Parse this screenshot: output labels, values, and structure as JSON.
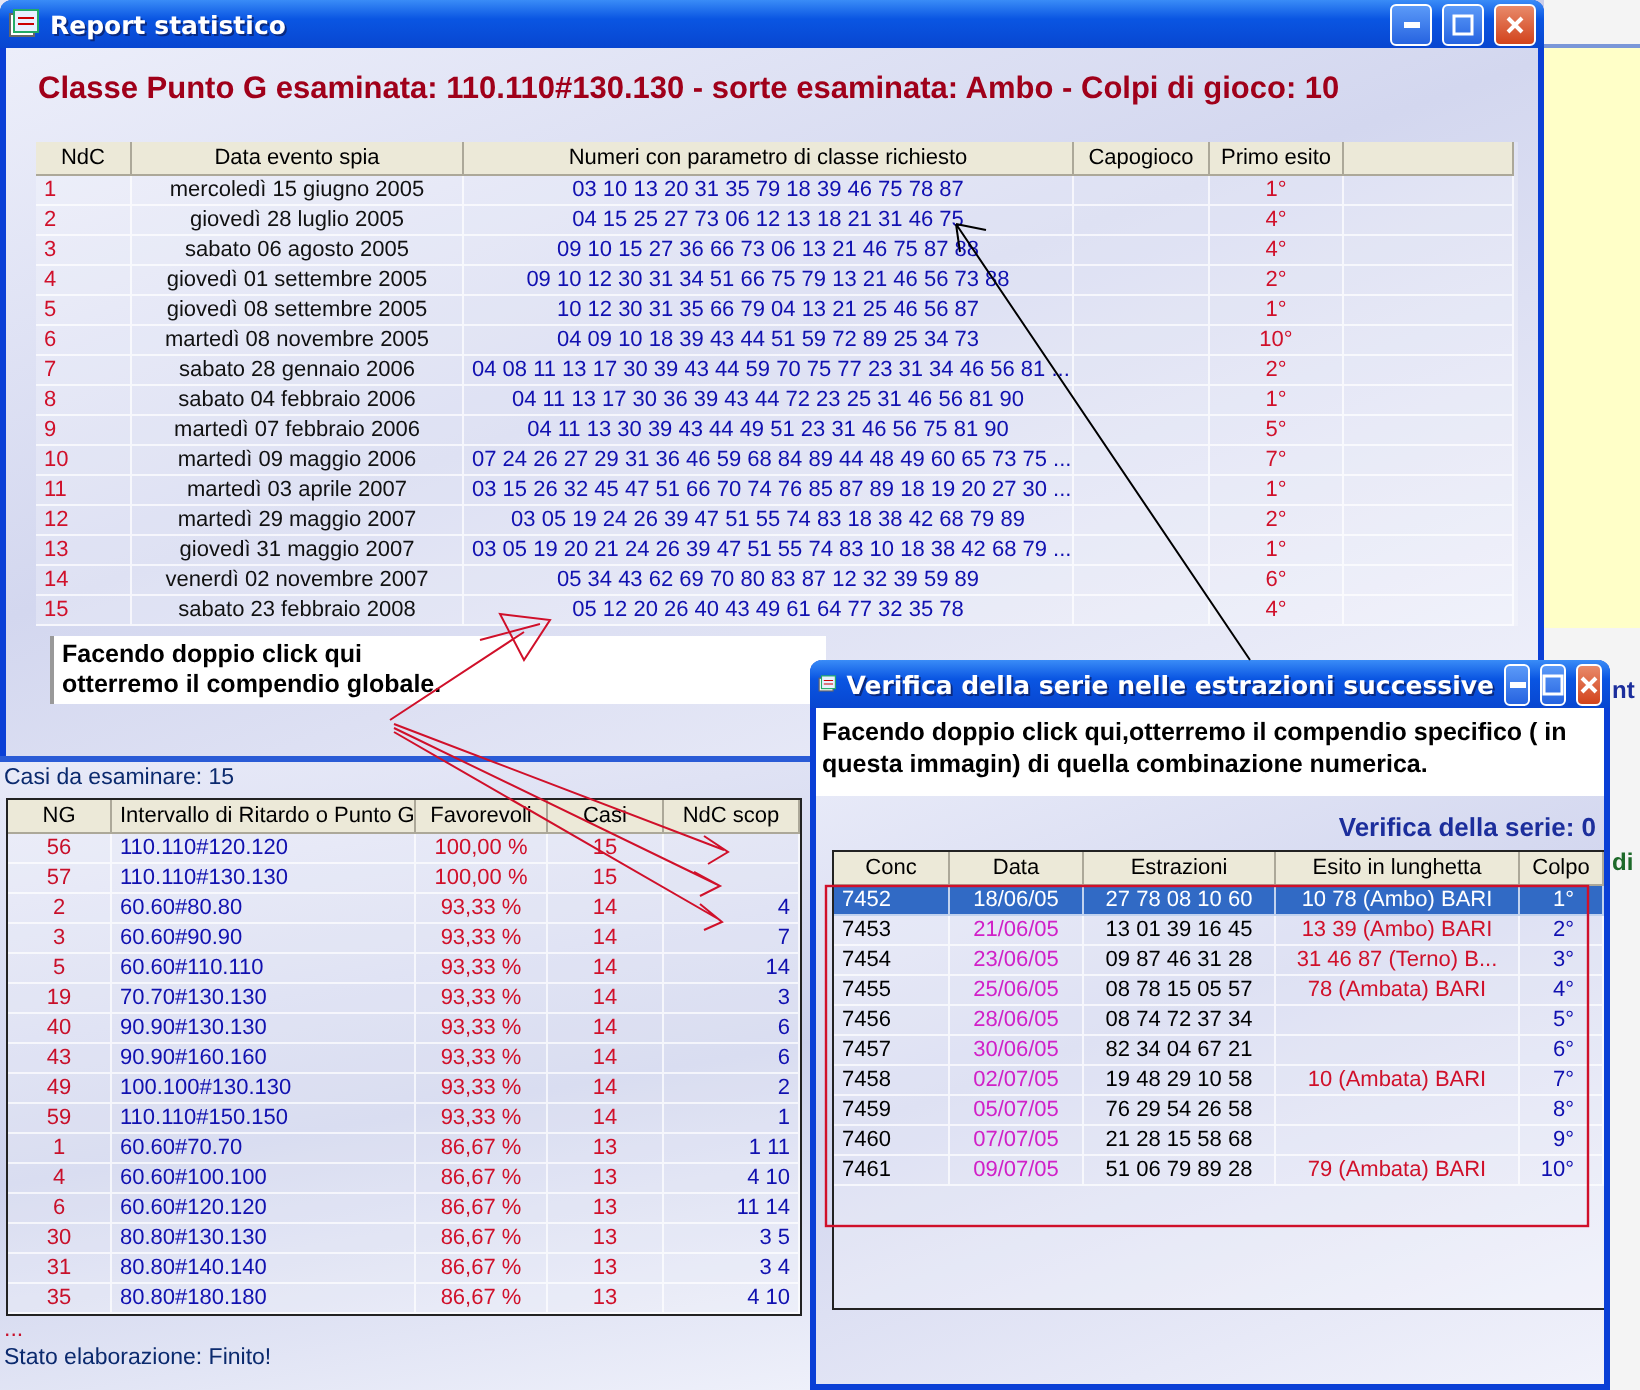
{
  "main_window": {
    "title": "Report statistico",
    "heading": "Classe Punto G esaminata: 110.110#130.130 - sorte esaminata: Ambo - Colpi di gioco: 10",
    "table": {
      "columns": [
        "NdC",
        "Data evento spia",
        "Numeri con parametro di classe richiesto",
        "Capogioco",
        "Primo esito"
      ],
      "rows": [
        {
          "ndc": "1",
          "data": "mercoledì 15 giugno 2005",
          "numeri": "03 10 13 20 31 35 79 18 39 46 75 78 87",
          "primo_esito": "1°"
        },
        {
          "ndc": "2",
          "data": "giovedì 28 luglio 2005",
          "numeri": "04 15 25 27 73 06 12 13 18 21 31 46 75",
          "primo_esito": "4°"
        },
        {
          "ndc": "3",
          "data": "sabato 06 agosto 2005",
          "numeri": "09 10 15 27 36 66 73 06 13 21 46 75 87 88",
          "primo_esito": "4°"
        },
        {
          "ndc": "4",
          "data": "giovedì 01 settembre 2005",
          "numeri": "09 10 12 30 31 34 51 66 75 79 13 21 46 56 73 88",
          "primo_esito": "2°"
        },
        {
          "ndc": "5",
          "data": "giovedì 08 settembre 2005",
          "numeri": "10 12 30 31 35 66 79 04 13 21 25 46 56 87",
          "primo_esito": "1°"
        },
        {
          "ndc": "6",
          "data": "martedì 08 novembre 2005",
          "numeri": "04 09 10 18 39 43 44 51 59 72 89 25 34 73",
          "primo_esito": "10°"
        },
        {
          "ndc": "7",
          "data": "sabato 28 gennaio 2006",
          "numeri": "04 08 11 13 17 30 39 43 44 59 70 75 77 23 31 34 46 56 81 ...",
          "primo_esito": "2°"
        },
        {
          "ndc": "8",
          "data": "sabato 04 febbraio 2006",
          "numeri": "04 11 13 17 30 36 39 43 44 72 23 25 31 46 56 81 90",
          "primo_esito": "1°"
        },
        {
          "ndc": "9",
          "data": "martedì 07 febbraio 2006",
          "numeri": "04 11 13 30 39 43 44 49 51 23 31 46 56 75 81 90",
          "primo_esito": "5°"
        },
        {
          "ndc": "10",
          "data": "martedì 09 maggio 2006",
          "numeri": "07 24 26 27 29 31 36 46 59 68 84 89 44 48 49 60 65 73 75 ...",
          "primo_esito": "7°"
        },
        {
          "ndc": "11",
          "data": "martedì 03 aprile 2007",
          "numeri": "03 15 26 32 45 47 51 66 70 74 76 85 87 89 18 19 20 27 30 ...",
          "primo_esito": "1°"
        },
        {
          "ndc": "12",
          "data": "martedì 29 maggio 2007",
          "numeri": "03 05 19 24 26 39 47 51 55 74 83 18 38 42 68 79 89",
          "primo_esito": "2°"
        },
        {
          "ndc": "13",
          "data": "giovedì 31 maggio 2007",
          "numeri": "03 05 19 20 21 24 26 39 47 51 55 74 83 10 18 38 42 68 79 ...",
          "primo_esito": "1°"
        },
        {
          "ndc": "14",
          "data": "venerdì 02 novembre 2007",
          "numeri": "05 34 43 62 69 70 80 83 87 12 32 39 59 89",
          "primo_esito": "6°"
        },
        {
          "ndc": "15",
          "data": "sabato 23 febbraio 2008",
          "numeri": "05 12 20 26 40 43 49 61 64 77 32 35 78",
          "primo_esito": "4°"
        }
      ]
    },
    "note": [
      "Facendo doppio click qui",
      "otterremo il compendio globale."
    ]
  },
  "cases_panel": {
    "caption": "Casi da esaminare: 15",
    "table": {
      "columns": [
        "NG",
        "Intervallo di Ritardo o Punto G",
        "Favorevoli",
        "Casi",
        "NdC scop"
      ],
      "rows": [
        {
          "ng": "56",
          "intervallo": "110.110#120.120",
          "favorevoli": "100,00 %",
          "casi": "15",
          "ndc": ""
        },
        {
          "ng": "57",
          "intervallo": "110.110#130.130",
          "favorevoli": "100,00 %",
          "casi": "15",
          "ndc": ""
        },
        {
          "ng": "2",
          "intervallo": "60.60#80.80",
          "favorevoli": "93,33 %",
          "casi": "14",
          "ndc": "4"
        },
        {
          "ng": "3",
          "intervallo": "60.60#90.90",
          "favorevoli": "93,33 %",
          "casi": "14",
          "ndc": "7"
        },
        {
          "ng": "5",
          "intervallo": "60.60#110.110",
          "favorevoli": "93,33 %",
          "casi": "14",
          "ndc": "14"
        },
        {
          "ng": "19",
          "intervallo": "70.70#130.130",
          "favorevoli": "93,33 %",
          "casi": "14",
          "ndc": "3"
        },
        {
          "ng": "40",
          "intervallo": "90.90#130.130",
          "favorevoli": "93,33 %",
          "casi": "14",
          "ndc": "6"
        },
        {
          "ng": "43",
          "intervallo": "90.90#160.160",
          "favorevoli": "93,33 %",
          "casi": "14",
          "ndc": "6"
        },
        {
          "ng": "49",
          "intervallo": "100.100#130.130",
          "favorevoli": "93,33 %",
          "casi": "14",
          "ndc": "2"
        },
        {
          "ng": "59",
          "intervallo": "110.110#150.150",
          "favorevoli": "93,33 %",
          "casi": "14",
          "ndc": "1"
        },
        {
          "ng": "1",
          "intervallo": "60.60#70.70",
          "favorevoli": "86,67 %",
          "casi": "13",
          "ndc": "1 11"
        },
        {
          "ng": "4",
          "intervallo": "60.60#100.100",
          "favorevoli": "86,67 %",
          "casi": "13",
          "ndc": "4 10"
        },
        {
          "ng": "6",
          "intervallo": "60.60#120.120",
          "favorevoli": "86,67 %",
          "casi": "13",
          "ndc": "11 14"
        },
        {
          "ng": "30",
          "intervallo": "80.80#130.130",
          "favorevoli": "86,67 %",
          "casi": "13",
          "ndc": "3 5"
        },
        {
          "ng": "31",
          "intervallo": "80.80#140.140",
          "favorevoli": "86,67 %",
          "casi": "13",
          "ndc": "3 4"
        },
        {
          "ng": "35",
          "intervallo": "80.80#180.180",
          "favorevoli": "86,67 %",
          "casi": "13",
          "ndc": "4 10"
        }
      ]
    },
    "ellipsis": "...",
    "status": "Stato elaborazione: Finito!"
  },
  "background_fragments": [
    "nt",
    "di"
  ],
  "verify_window": {
    "title": "Verifica della serie nelle estrazioni successive",
    "note": "Facendo doppio click qui,otterremo il compendio specifico ( in questa immagin) di quella combinazione numerica.",
    "background_heading": "Verifica della serie: 0",
    "table": {
      "columns": [
        "Conc",
        "Data",
        "Estrazioni",
        "Esito in lunghetta",
        "Colpo"
      ],
      "rows": [
        {
          "conc": "7452",
          "data": "18/06/05",
          "estrazioni": "27 78 08 10 60",
          "esito": "10 78   (Ambo) BARI",
          "colpo": "1°",
          "selected": true
        },
        {
          "conc": "7453",
          "data": "21/06/05",
          "estrazioni": "13 01 39 16 45",
          "esito": "13 39   (Ambo) BARI",
          "colpo": "2°",
          "selected": false
        },
        {
          "conc": "7454",
          "data": "23/06/05",
          "estrazioni": "09 87 46 31 28",
          "esito": "31 46 87   (Terno) B...",
          "colpo": "3°",
          "selected": false
        },
        {
          "conc": "7455",
          "data": "25/06/05",
          "estrazioni": "08 78 15 05 57",
          "esito": "78   (Ambata) BARI",
          "colpo": "4°",
          "selected": false
        },
        {
          "conc": "7456",
          "data": "28/06/05",
          "estrazioni": "08 74 72 37 34",
          "esito": "",
          "colpo": "5°",
          "selected": false
        },
        {
          "conc": "7457",
          "data": "30/06/05",
          "estrazioni": "82 34 04 67 21",
          "esito": "",
          "colpo": "6°",
          "selected": false
        },
        {
          "conc": "7458",
          "data": "02/07/05",
          "estrazioni": "19 48 29 10 58",
          "esito": "10   (Ambata) BARI",
          "colpo": "7°",
          "selected": false
        },
        {
          "conc": "7459",
          "data": "05/07/05",
          "estrazioni": "76 29 54 26 58",
          "esito": "",
          "colpo": "8°",
          "selected": false
        },
        {
          "conc": "7460",
          "data": "07/07/05",
          "estrazioni": "21 28 15 58 68",
          "esito": "",
          "colpo": "9°",
          "selected": false
        },
        {
          "conc": "7461",
          "data": "09/07/05",
          "estrazioni": "51 06 79 89 28",
          "esito": "79   (Ambata) BARI",
          "colpo": "10°",
          "selected": false
        }
      ]
    }
  }
}
